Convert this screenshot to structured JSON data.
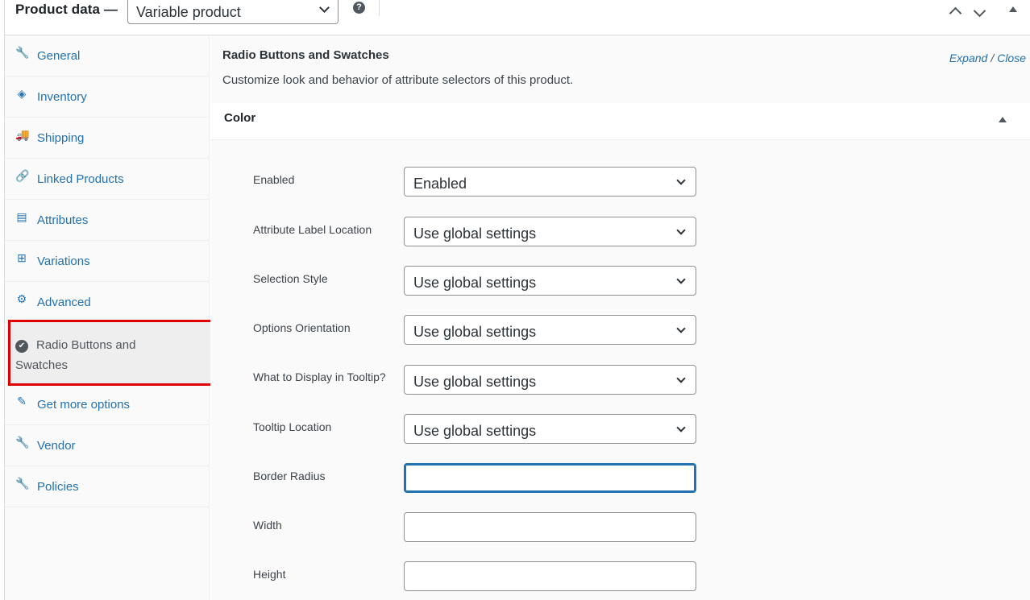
{
  "header": {
    "title": "Product data —",
    "product_type": "Variable product",
    "help_glyph": "?"
  },
  "tabs": [
    {
      "label": "General",
      "icon": "wrench-icon",
      "glyph": "🔧"
    },
    {
      "label": "Inventory",
      "icon": "tag-icon",
      "glyph": "◈"
    },
    {
      "label": "Shipping",
      "icon": "truck-icon",
      "glyph": "🚚"
    },
    {
      "label": "Linked Products",
      "icon": "link-icon",
      "glyph": "🔗"
    },
    {
      "label": "Attributes",
      "icon": "list-icon",
      "glyph": "▤"
    },
    {
      "label": "Variations",
      "icon": "grid-icon",
      "glyph": "⊞"
    },
    {
      "label": "Advanced",
      "icon": "gear-icon",
      "glyph": "⚙"
    },
    {
      "label": "Radio Buttons and Swatches",
      "icon": "check-circle-icon",
      "glyph": "✔",
      "active": true
    },
    {
      "label": "Get more options",
      "icon": "plugin-icon",
      "glyph": "✎"
    },
    {
      "label": "Vendor",
      "icon": "wrench-icon",
      "glyph": "🔧"
    },
    {
      "label": "Policies",
      "icon": "wrench-icon",
      "glyph": "🔧"
    }
  ],
  "main": {
    "section_title": "Radio Buttons and Swatches",
    "expand_label": "Expand",
    "expand_sep": "/",
    "close_label": "Close",
    "description": "Customize look and behavior of attribute selectors of this product.",
    "attribute_name": "Color",
    "fields": [
      {
        "label": "Enabled",
        "type": "select",
        "value": "Enabled"
      },
      {
        "label": "Attribute Label Location",
        "type": "select",
        "value": "Use global settings"
      },
      {
        "label": "Selection Style",
        "type": "select",
        "value": "Use global settings"
      },
      {
        "label": "Options Orientation",
        "type": "select",
        "value": "Use global settings"
      },
      {
        "label": "What to Display in Tooltip?",
        "type": "select",
        "value": "Use global settings"
      },
      {
        "label": "Tooltip Location",
        "type": "select",
        "value": "Use global settings"
      },
      {
        "label": "Border Radius",
        "type": "text",
        "value": ""
      },
      {
        "label": "Width",
        "type": "text",
        "value": ""
      },
      {
        "label": "Height",
        "type": "text",
        "value": ""
      }
    ]
  },
  "colors": {
    "link": "#2271b1",
    "highlight_border": "#e10000"
  }
}
